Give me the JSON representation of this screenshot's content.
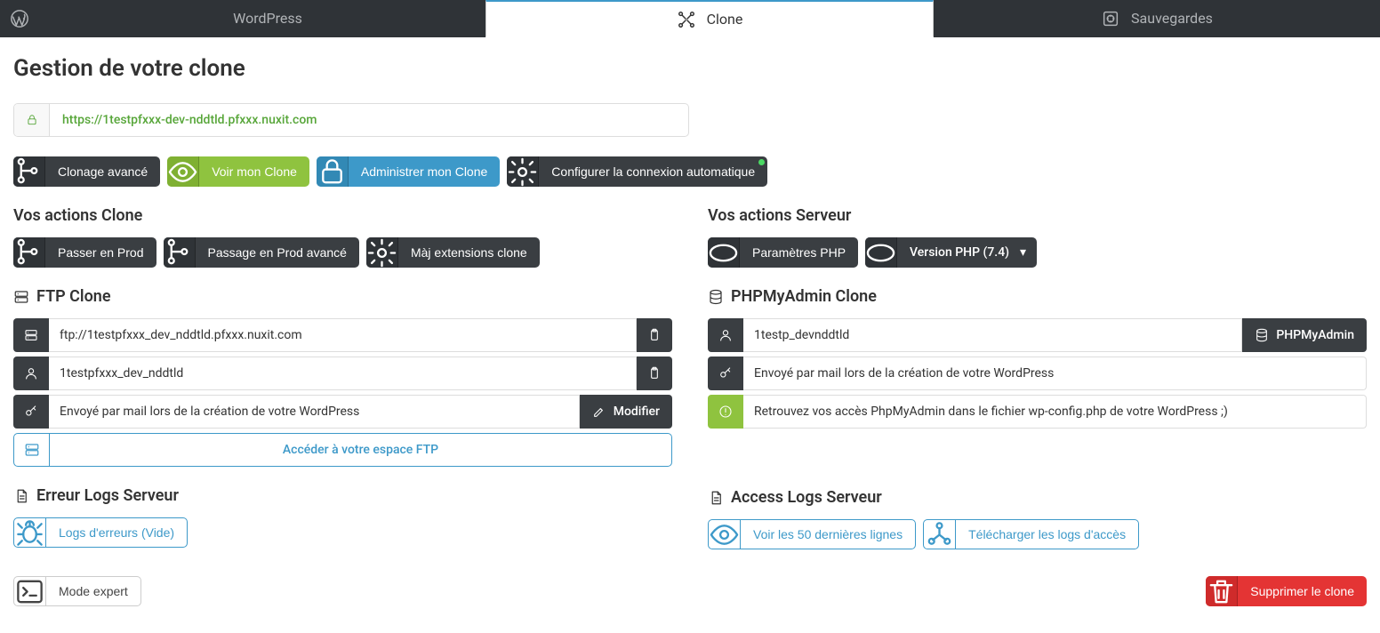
{
  "tabs": {
    "wordpress": "WordPress",
    "clone": "Clone",
    "backups": "Sauvegardes"
  },
  "page": {
    "title": "Gestion de votre clone",
    "url": "https://1testpfxxx-dev-nddtld.pfxxx.nuxit.com"
  },
  "toolbar": {
    "advanced_clone": "Clonage avancé",
    "view_clone": "Voir mon Clone",
    "admin_clone": "Administrer mon Clone",
    "config_auto": "Configurer la connexion automatique"
  },
  "clone_actions": {
    "title": "Vos actions Clone",
    "to_prod": "Passer en Prod",
    "to_prod_advanced": "Passage en Prod avancé",
    "update_ext": "Màj extensions clone"
  },
  "server_actions": {
    "title": "Vos actions Serveur",
    "php_params": "Paramètres PHP",
    "php_version": "Version PHP (7.4)"
  },
  "ftp": {
    "title": "FTP Clone",
    "url": "ftp://1testpfxxx_dev_nddtld.pfxxx.nuxit.com",
    "user": "1testpfxxx_dev_nddtld",
    "password_hint": "Envoyé par mail lors de la création de votre WordPress",
    "modify": "Modifier",
    "access": "Accéder à votre espace FTP"
  },
  "pma": {
    "title": "PHPMyAdmin Clone",
    "user": "1testp_devnddtld",
    "button": "PHPMyAdmin",
    "password_hint": "Envoyé par mail lors de la création de votre WordPress",
    "hint": "Retrouvez vos accès PhpMyAdmin dans le fichier wp-config.php de votre WordPress ;)"
  },
  "error_logs": {
    "title": "Erreur Logs Serveur",
    "button": "Logs d'erreurs (Vide)"
  },
  "access_logs": {
    "title": "Access Logs Serveur",
    "view50": "Voir les 50 dernières lignes",
    "download": "Télécharger les logs d'accès"
  },
  "footer": {
    "expert_mode": "Mode expert",
    "delete_clone": "Supprimer le clone"
  }
}
